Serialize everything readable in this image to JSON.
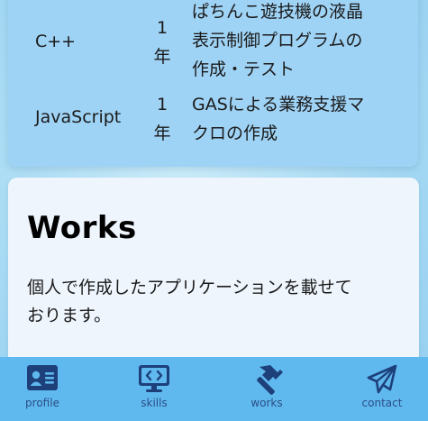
{
  "skills": [
    {
      "lang": "C++",
      "years": [
        "1",
        "年"
      ],
      "desc": [
        "ぱちんこ遊技機の液晶",
        "表示制御プログラムの",
        "作成・テスト"
      ]
    },
    {
      "lang": "JavaScript",
      "years": [
        "1",
        "年"
      ],
      "desc": [
        "GASによる業務支援マ",
        "クロの作成"
      ]
    }
  ],
  "works": {
    "title": "Works",
    "description_lines": [
      "個人で作成したアプリケーションを載せて",
      "おります。"
    ]
  },
  "nav": {
    "items": [
      {
        "label": "profile",
        "icon": "id-card-icon"
      },
      {
        "label": "skills",
        "icon": "code-monitor-icon"
      },
      {
        "label": "works",
        "icon": "hammer-icon"
      },
      {
        "label": "contact",
        "icon": "paper-plane-icon"
      }
    ],
    "icon_color": "#1d3f7a",
    "bar_color": "#5fb8ee"
  }
}
